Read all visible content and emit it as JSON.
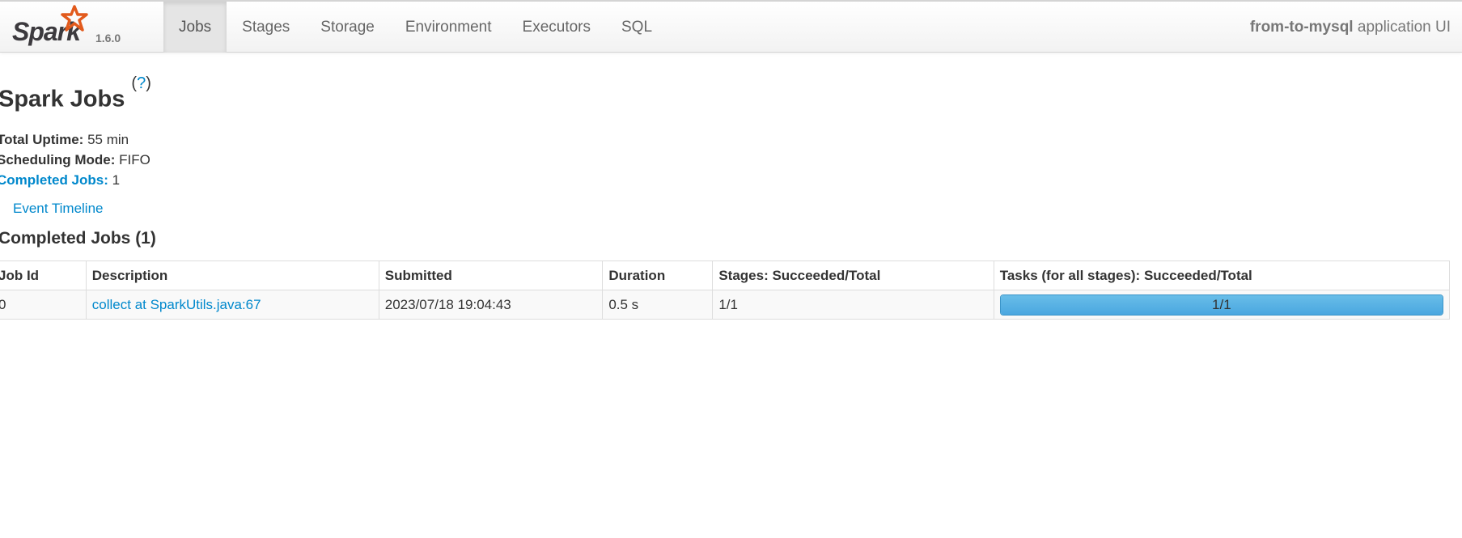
{
  "brand": {
    "name": "Spark",
    "version": "1.6.0"
  },
  "nav": {
    "items": [
      {
        "label": "Jobs",
        "active": true
      },
      {
        "label": "Stages",
        "active": false
      },
      {
        "label": "Storage",
        "active": false
      },
      {
        "label": "Environment",
        "active": false
      },
      {
        "label": "Executors",
        "active": false
      },
      {
        "label": "SQL",
        "active": false
      }
    ],
    "app_name": "from-to-mysql",
    "app_suffix": " application UI"
  },
  "page": {
    "title": "Spark Jobs",
    "help_symbol": "?",
    "summary": {
      "uptime_label": "Total Uptime:",
      "uptime_value": " 55 min",
      "mode_label": "Scheduling Mode:",
      "mode_value": " FIFO",
      "completed_label": "Completed Jobs:",
      "completed_value": " 1"
    },
    "event_timeline": "Event Timeline",
    "section_title": "Completed Jobs (1)"
  },
  "table": {
    "headers": [
      "Job Id",
      "Description",
      "Submitted",
      "Duration",
      "Stages: Succeeded/Total",
      "Tasks (for all stages): Succeeded/Total"
    ],
    "rows": [
      {
        "job_id": "0",
        "description": "collect at SparkUtils.java:67",
        "submitted": "2023/07/18 19:04:43",
        "duration": "0.5 s",
        "stages": "1/1",
        "tasks": "1/1",
        "tasks_progress": 1.0
      }
    ]
  },
  "colors": {
    "link": "#0088cc",
    "progress": "#4aa7e0",
    "brand_star": "#e25a1c"
  }
}
